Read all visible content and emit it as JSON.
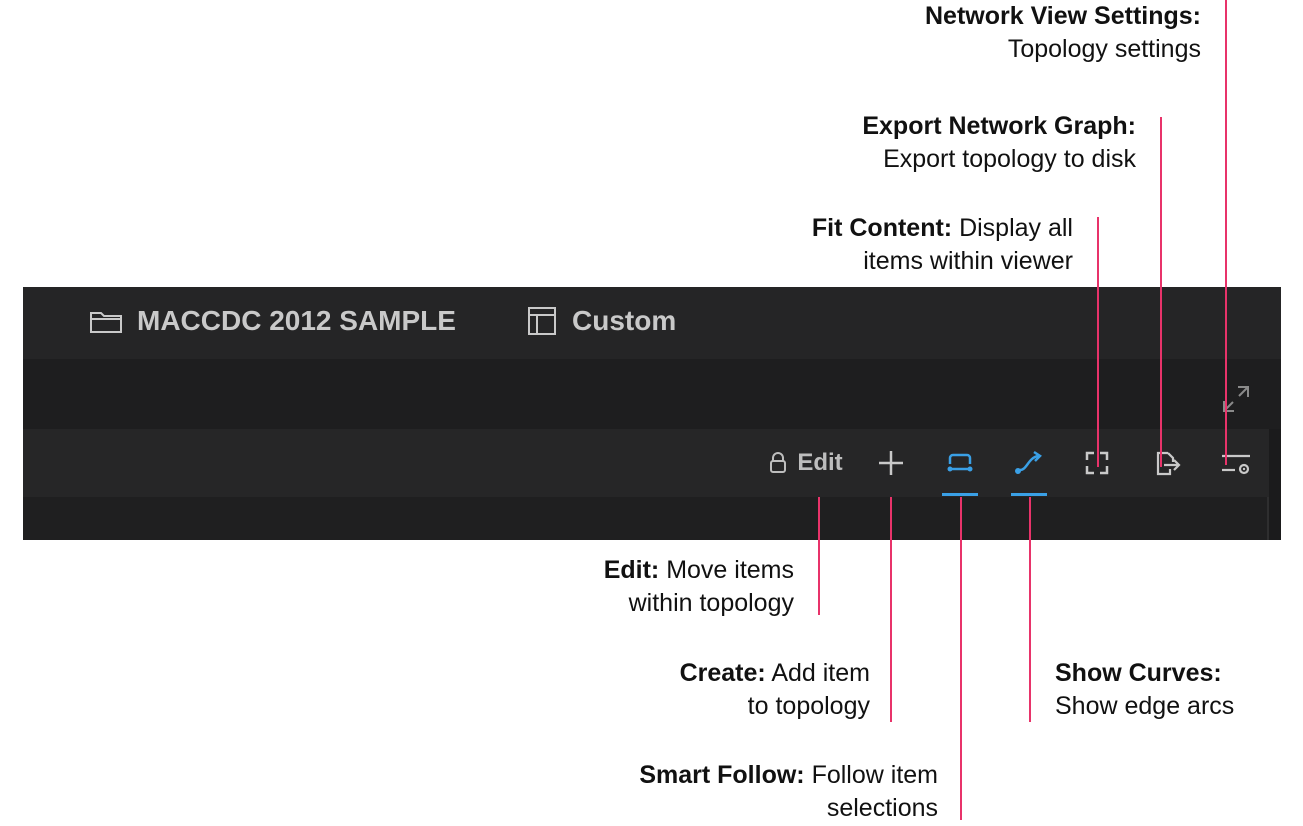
{
  "callouts": {
    "network_view_settings": {
      "title": "Network View Settings:",
      "desc": "Topology settings"
    },
    "export_network_graph": {
      "title": "Export Network Graph:",
      "desc": "Export topology to disk"
    },
    "fit_content": {
      "title": "Fit Content:",
      "desc_line1": "Display all",
      "desc_line2": "items within viewer"
    },
    "edit": {
      "title": "Edit:",
      "desc_line1": "Move items",
      "desc_line2": "within topology"
    },
    "create": {
      "title": "Create:",
      "desc_line1": "Add item",
      "desc_line2": "to topology"
    },
    "show_curves": {
      "title": "Show Curves:",
      "desc": "Show edge arcs"
    },
    "smart_follow": {
      "title": "Smart Follow:",
      "desc_line1": "Follow item",
      "desc_line2": "selections"
    }
  },
  "app": {
    "dataset_title": "MACCDC 2012 SAMPLE",
    "layout_name": "Custom",
    "toolbar": {
      "edit_label": "Edit",
      "smart_follow_active": true,
      "show_curves_active": true
    }
  },
  "colors": {
    "callout_line": "#e8336a",
    "active_accent": "#3aa0e6",
    "app_background": "#1b1b1c"
  },
  "icons": [
    "folder-icon",
    "layout-icon",
    "expand-icon",
    "lock-icon",
    "plus-icon",
    "smart-follow-icon",
    "curve-icon",
    "fit-content-icon",
    "export-icon",
    "settings-icon"
  ]
}
